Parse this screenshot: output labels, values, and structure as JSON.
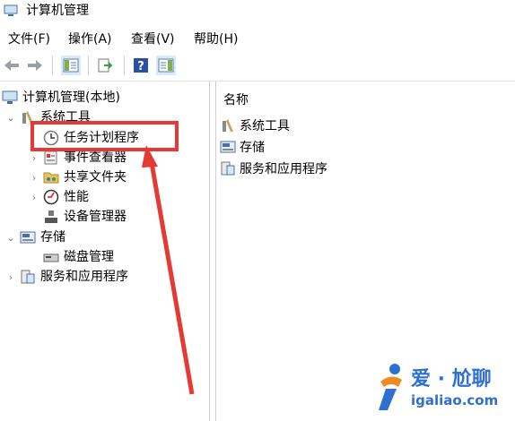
{
  "window": {
    "title": "计算机管理"
  },
  "menu": [
    "文件(F)",
    "操作(A)",
    "查看(V)",
    "帮助(H)"
  ],
  "toolbar": {
    "buttons": [
      "back-icon",
      "forward-icon",
      "show-hide-console-tree-icon",
      "export-list-icon",
      "help-icon",
      "show-hide-action-pane-icon"
    ]
  },
  "tree": {
    "root": "计算机管理(本地)",
    "system_tools": "系统工具",
    "task_scheduler": "任务计划程序",
    "event_viewer": "事件查看器",
    "shared_folders": "共享文件夹",
    "performance": "性能",
    "device_manager": "设备管理器",
    "storage": "存储",
    "disk_management": "磁盘管理",
    "services_apps": "服务和应用程序"
  },
  "list": {
    "header": "名称",
    "items": [
      "系统工具",
      "存储",
      "服务和应用程序"
    ]
  },
  "watermark": {
    "title": "爱 · 尬聊",
    "url": "igaliao.com"
  },
  "colors": {
    "highlight": "#e53935",
    "watermark": "#2f6fcf",
    "watermark_accent": "#f08a24"
  }
}
